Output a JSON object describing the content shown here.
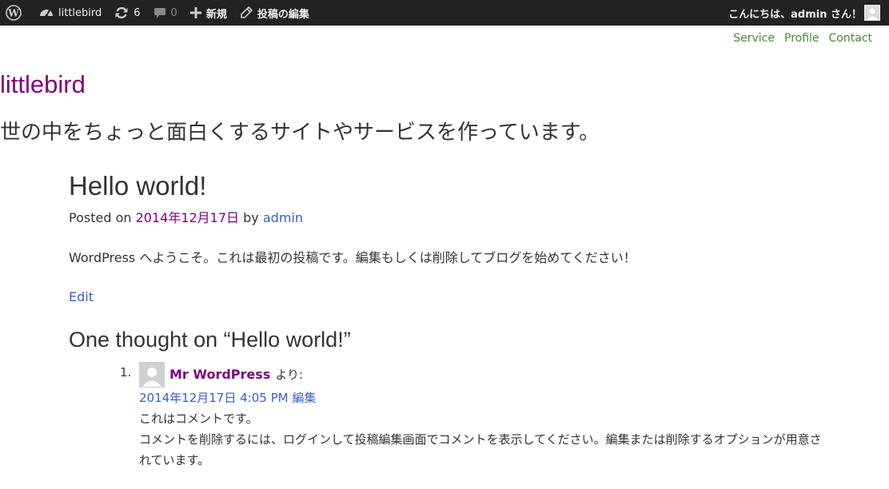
{
  "adminbar": {
    "site_name": "littlebird",
    "updates_count": "6",
    "comments_count": "0",
    "new_label": "新規",
    "edit_post_label": "投稿の編集",
    "greeting": "こんにちは、admin さん！",
    "icons": {
      "wp": "wordpress-logo-icon",
      "site": "dashboard-icon",
      "updates": "refresh-icon",
      "comments": "speech-bubble-icon",
      "new": "plus-icon",
      "edit": "pencil-icon",
      "avatar": "user-avatar-icon"
    }
  },
  "nav": {
    "items": [
      "Service",
      "Profile",
      "Contact"
    ]
  },
  "site": {
    "title": "littlebird",
    "description": "世の中をちょっと面白くするサイトやサービスを作っています。"
  },
  "post": {
    "title": "Hello world!",
    "posted_on_prefix": "Posted on",
    "date": "2014年12月17日",
    "by_label": "by",
    "author": "admin",
    "content": "WordPress へようこそ。これは最初の投稿です。編集もしくは削除してブログを始めてください！",
    "edit_label": "Edit"
  },
  "comments": {
    "title": "One thought on “Hello world!”",
    "list": [
      {
        "number": "1.",
        "author": "Mr WordPress",
        "says": "より:",
        "datetime": "2014年12月17日 4:05 PM",
        "edit": "編集",
        "line1": "これはコメントです。",
        "line2": "コメントを削除するには、ログインして投稿編集画面でコメントを表示してください。編集または削除するオプションが用意されています。"
      }
    ]
  },
  "colors": {
    "adminbar_bg": "#222222",
    "site_title": "#800080",
    "link_visited": "#800080",
    "link": "#3a5fcd",
    "nav_link": "#4a8a3a"
  }
}
